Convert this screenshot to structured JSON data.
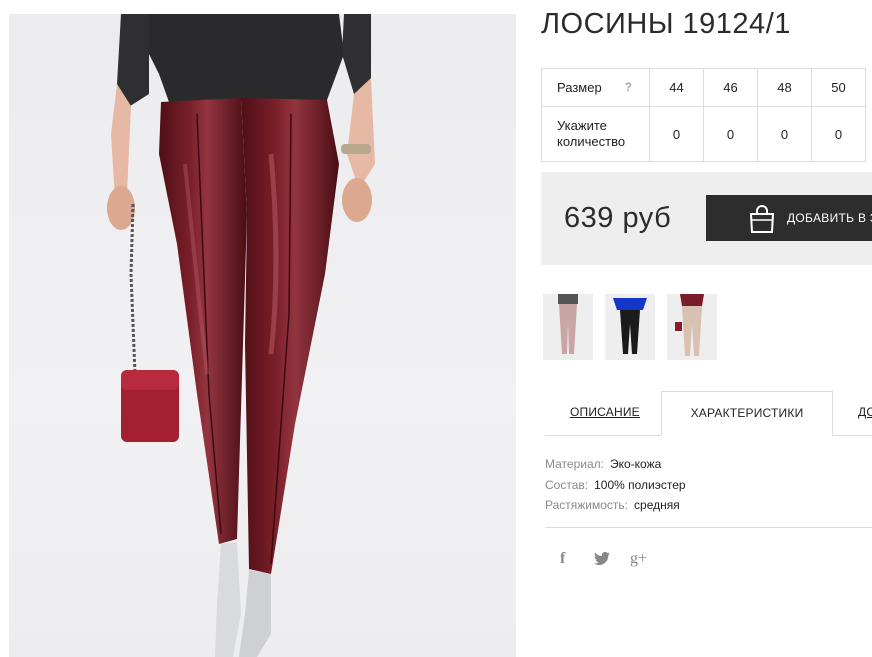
{
  "product": {
    "title": "ЛОСИНЫ 19124/1"
  },
  "size_table": {
    "size_label": "Размер",
    "help_icon": "?",
    "qty_label_line1": "Укажите",
    "qty_label_line2": "количество",
    "sizes": [
      "44",
      "46",
      "48",
      "50"
    ],
    "quantities": [
      "0",
      "0",
      "0",
      "0"
    ]
  },
  "purchase": {
    "price": "639 руб",
    "add_to_cart_label": "ДОБАВИТЬ В З",
    "button_icon": "shopping-bag-icon"
  },
  "thumbnails": [
    {
      "alt": "burgundy leggings front"
    },
    {
      "alt": "black leggings with blue top"
    },
    {
      "alt": "beige leggings with burgundy top"
    }
  ],
  "tabs": {
    "description": "ОПИСАНИЕ",
    "characteristics": "ХАРАКТЕРИСТИКИ",
    "delivery": "ДО"
  },
  "specs": {
    "material_key": "Материал:",
    "material_val": "Эко-кожа",
    "composition_key": "Состав:",
    "composition_val": "100% полиэстер",
    "stretch_key": "Растяжимость:",
    "stretch_val": "средняя"
  },
  "social": {
    "facebook": "f",
    "twitter": "twitter-icon",
    "googleplus": "g+"
  },
  "colors": {
    "leather": "#6e1a22",
    "button_bg": "#2d2d2d",
    "price_bg": "#eeeeee"
  }
}
